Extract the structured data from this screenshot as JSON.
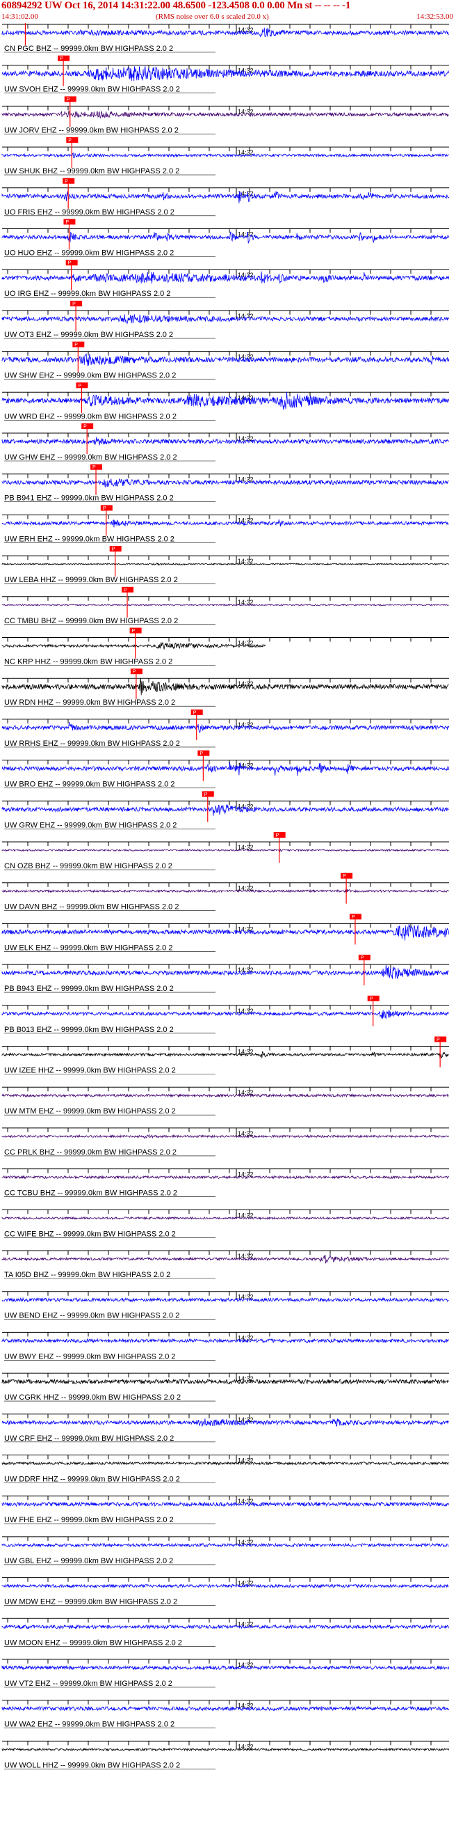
{
  "header": {
    "title": "60894292 UW Oct 16, 2014 14:31:22.00   48.6500 -123.4508  0.0 0.00 Mn st -- -- --  -1",
    "start_time": "14:31:02.00",
    "noise_note": "(RMS noise over 6.0 s scaled 20.0 x)",
    "end_time": "14:32:53.00"
  },
  "minute_tick_label": "14:32",
  "pick_label": "P",
  "channel_suffix": " -- 99999.0km BW  HIGHPASS  2.0  2",
  "colors": {
    "red": "#ff0000",
    "blue": "#0000ff",
    "black": "#000000",
    "purple": "#400070"
  },
  "traces": [
    {
      "label": "CN PGC BHZ",
      "color": "blue",
      "pick": 0.052,
      "amp": 0.5,
      "events": [
        [
          0.19,
          0.12,
          0.5
        ],
        [
          0.58,
          0.02,
          2.8
        ]
      ]
    },
    {
      "label": "UW SVOH EHZ",
      "color": "blue",
      "pick": 0.137,
      "amp": 0.6,
      "events": [
        [
          0.22,
          0.15,
          1.8
        ],
        [
          0.31,
          0.25,
          1.2
        ]
      ]
    },
    {
      "label": "UW JORV EHZ",
      "color": "purple",
      "pick": 0.152,
      "amp": 0.4,
      "events": [
        [
          0.14,
          0.06,
          1.4
        ],
        [
          0.22,
          0.08,
          0.8
        ]
      ]
    },
    {
      "label": "UW SHUK BHZ",
      "color": "blue",
      "pick": 0.156,
      "amp": 0.3,
      "events": [
        [
          0.16,
          0.02,
          1.6
        ]
      ]
    },
    {
      "label": "UO FRIS EHZ",
      "color": "blue",
      "pick": 0.148,
      "amp": 0.5,
      "events": [
        [
          0.14,
          0.008,
          3
        ],
        [
          0.36,
          0.006,
          3
        ],
        [
          0.53,
          0.006,
          3
        ],
        [
          0.55,
          0.006,
          3
        ],
        [
          0.61,
          0.006,
          3
        ],
        [
          0.8,
          0.006,
          3
        ],
        [
          0.82,
          0.006,
          2.5
        ]
      ]
    },
    {
      "label": "UO HUO EHZ",
      "color": "blue",
      "pick": 0.15,
      "amp": 0.45,
      "events": [
        [
          0.15,
          0.01,
          3
        ],
        [
          0.34,
          0.008,
          3
        ],
        [
          0.37,
          0.008,
          3
        ],
        [
          0.51,
          0.008,
          3
        ],
        [
          0.55,
          0.007,
          3
        ],
        [
          0.66,
          0.006,
          2.5
        ],
        [
          0.8,
          0.006,
          3
        ],
        [
          0.83,
          0.006,
          2.8
        ]
      ]
    },
    {
      "label": "UO IRG EHZ",
      "color": "blue",
      "pick": 0.155,
      "amp": 0.5,
      "events": [
        [
          0.16,
          0.01,
          2.4
        ],
        [
          0.22,
          0.15,
          1.2
        ],
        [
          0.33,
          0.2,
          1.5
        ],
        [
          0.58,
          0.01,
          2.5
        ],
        [
          0.62,
          0.006,
          2
        ],
        [
          0.72,
          0.008,
          2.5
        ],
        [
          0.81,
          0.006,
          2.5
        ]
      ]
    },
    {
      "label": "UW OT3 EHZ",
      "color": "blue",
      "pick": 0.165,
      "amp": 0.5,
      "events": [
        [
          0.28,
          0.12,
          1.4
        ]
      ]
    },
    {
      "label": "UW SHW EHZ",
      "color": "blue",
      "pick": 0.17,
      "amp": 0.6,
      "events": [
        [
          0.19,
          0.08,
          1.6
        ],
        [
          0.96,
          0.004,
          2.2
        ]
      ]
    },
    {
      "label": "UW WRD EHZ",
      "color": "blue",
      "pick": 0.178,
      "amp": 0.6,
      "events": [
        [
          0.2,
          0.08,
          1.4
        ],
        [
          0.43,
          0.15,
          1.6
        ],
        [
          0.63,
          0.06,
          2.8
        ]
      ]
    },
    {
      "label": "UW GHW EHZ",
      "color": "blue",
      "pick": 0.19,
      "amp": 0.5,
      "events": [
        [
          0.21,
          0.02,
          1.6
        ]
      ]
    },
    {
      "label": "PB B941 EHZ",
      "color": "blue",
      "pick": 0.21,
      "amp": 0.5,
      "events": [
        [
          0.23,
          0.05,
          1.8
        ]
      ]
    },
    {
      "label": "UW ERH EHZ",
      "color": "blue",
      "pick": 0.233,
      "amp": 0.4,
      "events": [
        [
          0.25,
          0.03,
          1.5
        ],
        [
          0.62,
          0.006,
          1.8
        ]
      ]
    },
    {
      "label": "UW LEBA HHZ",
      "color": "black",
      "pick": 0.253,
      "amp": 0.15,
      "events": [
        [
          0.35,
          0.08,
          0.6
        ]
      ]
    },
    {
      "label": "CC TMBU BHZ",
      "color": "purple",
      "pick": 0.28,
      "amp": 0.15,
      "events": [
        [
          0.28,
          0.006,
          1.6
        ],
        [
          0.51,
          0.005,
          0.6
        ]
      ]
    },
    {
      "label": "NC KRP HHZ",
      "color": "black",
      "pick": 0.298,
      "amp": 0.3,
      "events": [
        [
          0.36,
          0.08,
          2.2
        ]
      ],
      "end": 0.59
    },
    {
      "label": "UW RDN HHZ",
      "color": "black",
      "pick": 0.3,
      "amp": 0.6,
      "events": [
        [
          0.31,
          0.012,
          3
        ],
        [
          0.34,
          0.05,
          1.4
        ]
      ]
    },
    {
      "label": "UW RRHS EHZ",
      "color": "blue",
      "pick": 0.435,
      "amp": 0.5,
      "events": [
        [
          0.15,
          0.006,
          2
        ],
        [
          0.44,
          0.008,
          2
        ]
      ]
    },
    {
      "label": "UW BRO EHZ",
      "color": "blue",
      "pick": 0.45,
      "amp": 0.5,
      "events": [
        [
          0.46,
          0.01,
          3
        ],
        [
          0.51,
          0.008,
          3
        ],
        [
          0.53,
          0.008,
          3
        ],
        [
          0.61,
          0.008,
          3
        ],
        [
          0.66,
          0.007,
          3
        ],
        [
          0.71,
          0.006,
          3
        ],
        [
          0.77,
          0.006,
          3
        ]
      ]
    },
    {
      "label": "UW GRW EHZ",
      "color": "blue",
      "pick": 0.46,
      "amp": 0.5,
      "events": [
        [
          0.47,
          0.01,
          3
        ],
        [
          0.49,
          0.04,
          1.8
        ]
      ]
    },
    {
      "label": "CN OZB BHZ",
      "color": "purple",
      "pick": 0.62,
      "amp": 0.2,
      "events": [
        [
          0.62,
          0.005,
          3
        ]
      ]
    },
    {
      "label": "UW DAVN BHZ",
      "color": "purple",
      "pick": 0.77,
      "amp": 0.25,
      "events": [
        [
          0.77,
          0.005,
          2.8
        ]
      ]
    },
    {
      "label": "UW ELK EHZ",
      "color": "blue",
      "pick": 0.79,
      "amp": 0.5,
      "events": [
        [
          0.9,
          0.12,
          3.2
        ]
      ]
    },
    {
      "label": "PB B943 EHZ",
      "color": "blue",
      "pick": 0.81,
      "amp": 0.5,
      "events": [
        [
          0.86,
          0.06,
          2.8
        ]
      ]
    },
    {
      "label": "PB B013 EHZ",
      "color": "blue",
      "pick": 0.83,
      "amp": 0.4,
      "events": [
        [
          0.85,
          0.03,
          2.8
        ]
      ]
    },
    {
      "label": "UW IZEE HHZ",
      "color": "black",
      "pick": 0.98,
      "amp": 0.3,
      "events": [
        [
          0.58,
          0.01,
          3
        ],
        [
          0.83,
          0.008,
          3
        ],
        [
          0.98,
          0.01,
          3
        ]
      ]
    },
    {
      "label": "UW MTM EHZ",
      "color": "purple",
      "pick": -1,
      "amp": 0.3,
      "events": []
    },
    {
      "label": "CC PRLK BHZ",
      "color": "purple",
      "pick": -1,
      "amp": 0.25,
      "events": [
        [
          0.32,
          0.012,
          2
        ]
      ]
    },
    {
      "label": "CC TCBU BHZ",
      "color": "purple",
      "pick": -1,
      "amp": 0.3,
      "events": []
    },
    {
      "label": "CC WIFE BHZ",
      "color": "purple",
      "pick": -1,
      "amp": 0.25,
      "events": []
    },
    {
      "label": "TA I05D BHZ",
      "color": "purple",
      "pick": -1,
      "amp": 0.3,
      "events": [
        [
          0.72,
          0.05,
          2.8
        ]
      ]
    },
    {
      "label": "UW BEND EHZ",
      "color": "blue",
      "pick": -1,
      "amp": 0.4,
      "events": []
    },
    {
      "label": "UW BWY EHZ",
      "color": "blue",
      "pick": -1,
      "amp": 0.4,
      "events": []
    },
    {
      "label": "UW CGRK HHZ",
      "color": "black",
      "pick": -1,
      "amp": 0.5,
      "events": []
    },
    {
      "label": "UW CRF EHZ",
      "color": "blue",
      "pick": -1,
      "amp": 0.45,
      "events": [
        [
          0.45,
          0.08,
          1.3
        ],
        [
          0.74,
          0.04,
          1.4
        ]
      ]
    },
    {
      "label": "UW DDRF HHZ",
      "color": "black",
      "pick": -1,
      "amp": 0.3,
      "events": []
    },
    {
      "label": "UW FHE EHZ",
      "color": "blue",
      "pick": -1,
      "amp": 0.45,
      "events": []
    },
    {
      "label": "UW GBL EHZ",
      "color": "blue",
      "pick": -1,
      "amp": 0.35,
      "events": []
    },
    {
      "label": "UW MDW EHZ",
      "color": "blue",
      "pick": -1,
      "amp": 0.35,
      "events": []
    },
    {
      "label": "UW MOON EHZ",
      "color": "blue",
      "pick": -1,
      "amp": 0.4,
      "events": []
    },
    {
      "label": "UW VT2 EHZ",
      "color": "blue",
      "pick": -1,
      "amp": 0.4,
      "events": []
    },
    {
      "label": "UW WA2 EHZ",
      "color": "blue",
      "pick": -1,
      "amp": 0.45,
      "events": []
    },
    {
      "label": "UW WOLL HHZ",
      "color": "black",
      "pick": -1,
      "amp": 0.25,
      "events": []
    }
  ]
}
